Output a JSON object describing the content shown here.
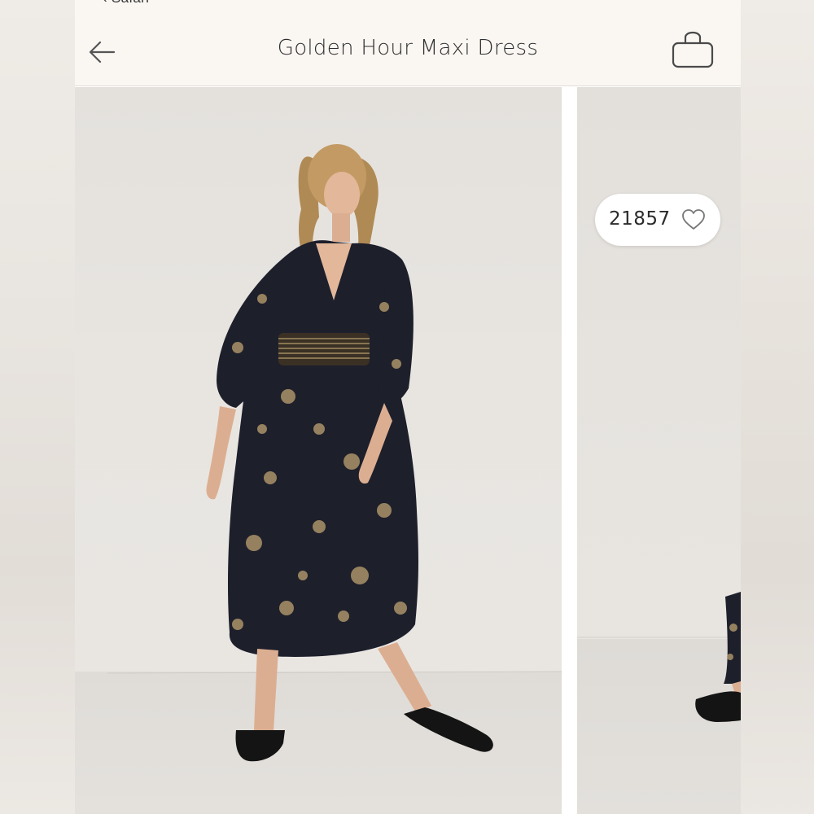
{
  "status_bar": {
    "text": "‹ Safari"
  },
  "header": {
    "title": "Golden Hour Maxi Dress",
    "back_icon": "arrow-left-icon",
    "bag_icon": "shopping-bag-icon"
  },
  "gallery": {
    "like_count": "21857",
    "like_icon": "heart-outline-icon",
    "photos": [
      {
        "subject": "model-in-floral-maxi-dress"
      },
      {
        "subject": "partial-model-sandal"
      }
    ]
  },
  "colors": {
    "header_bg": "#faf7f3",
    "dress": "#1d1f2b",
    "print": "#b49a6c",
    "backdrop": "#e6e3df"
  }
}
